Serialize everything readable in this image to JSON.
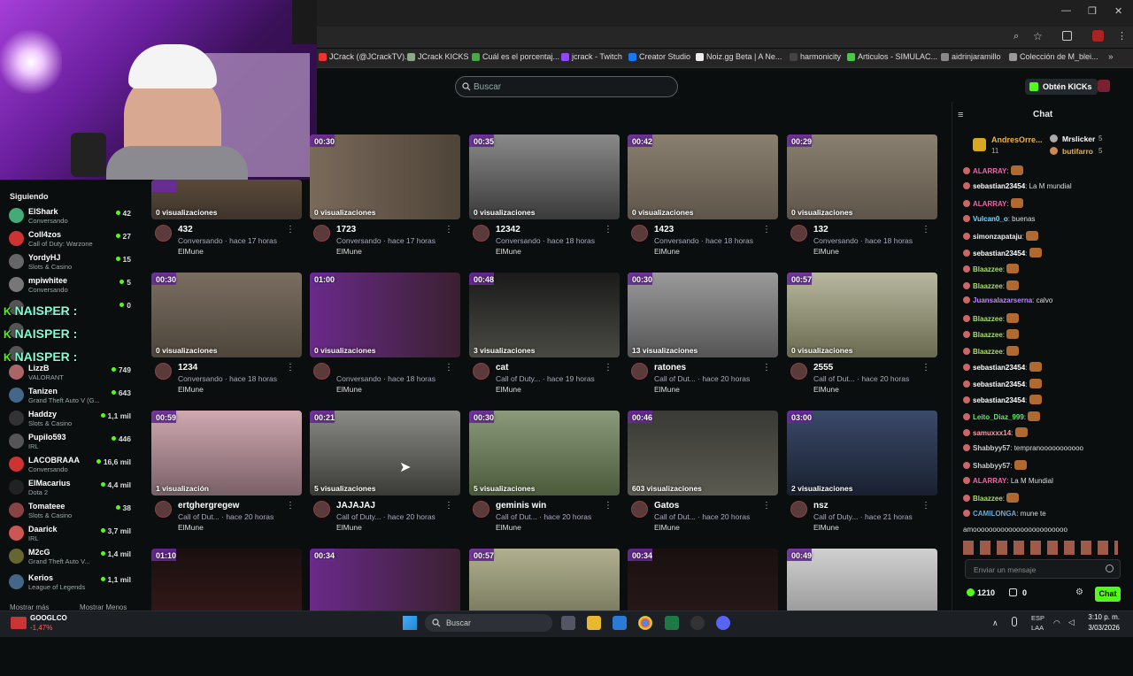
{
  "bookmarks": [
    {
      "label": "JCrack (@JCrackTV)...",
      "color": "#e33"
    },
    {
      "label": "JCrack KICKS",
      "color": "#8a8"
    },
    {
      "label": "Cuál es el porcentaj...",
      "color": "#4a4"
    },
    {
      "label": "jcrack - Twitch",
      "color": "#9146ff"
    },
    {
      "label": "Creator Studio",
      "color": "#1877f2"
    },
    {
      "label": "Noiz.gg Beta | A Ne...",
      "color": "#eee"
    },
    {
      "label": "harmonicity",
      "color": "#444"
    },
    {
      "label": "Articulos - SIMULAC...",
      "color": "#4c4"
    },
    {
      "label": "aidrinjaramillo",
      "color": "#888"
    },
    {
      "label": "Colección de M_blei...",
      "color": "#999"
    }
  ],
  "header": {
    "search_placeholder": "Buscar",
    "kicks_label": "Obtén KICKs"
  },
  "sidebar": {
    "title": "Siguiendo",
    "channels": [
      {
        "name": "ElShark",
        "category": "Conversando",
        "viewers": "42",
        "color": "#4a7"
      },
      {
        "name": "Coll4zos",
        "category": "Call of Duty: Warzone",
        "viewers": "27",
        "color": "#c33"
      },
      {
        "name": "YordyHJ",
        "category": "Slots & Casino",
        "viewers": "15",
        "color": "#666"
      },
      {
        "name": "mpiwhitee",
        "category": "Conversando",
        "viewers": "5",
        "color": "#777"
      },
      {
        "name": "",
        "category": "Conversando",
        "viewers": "0",
        "color": "#555"
      },
      {
        "name": "",
        "category": "",
        "viewers": "",
        "color": "#555"
      },
      {
        "name": "",
        "category": "",
        "viewers": "",
        "color": "#555"
      },
      {
        "name": "LizzB",
        "category": "VALORANT",
        "viewers": "749",
        "color": "#a66"
      },
      {
        "name": "Tanizen",
        "category": "Grand Theft Auto V (G...",
        "viewers": "643",
        "color": "#468"
      },
      {
        "name": "Haddzy",
        "category": "Slots & Casino",
        "viewers": "1,1 mil",
        "color": "#333"
      },
      {
        "name": "Pupilo593",
        "category": "IRL",
        "viewers": "446",
        "color": "#555"
      },
      {
        "name": "LACOBRAAA",
        "category": "Conversando",
        "viewers": "16,6 mil",
        "color": "#c33"
      },
      {
        "name": "ElMacarius",
        "category": "Dota 2",
        "viewers": "4,4 mil",
        "color": "#222"
      },
      {
        "name": "Tomateee",
        "category": "Slots & Casino",
        "viewers": "38",
        "color": "#844"
      },
      {
        "name": "Daarick",
        "category": "IRL",
        "viewers": "3,7 mil",
        "color": "#c55"
      },
      {
        "name": "M2cG",
        "category": "Grand Theft Auto V...",
        "viewers": "1,4 mil",
        "color": "#663"
      },
      {
        "name": "Kerios",
        "category": "League of Legends",
        "viewers": "1,1 mil",
        "color": "#468"
      }
    ],
    "overlay_text": "NAISPER",
    "show_more": "Mostrar más",
    "show_less": "Mostrar Menos"
  },
  "clips": [
    {
      "duration": "",
      "views": "0 visualizaciones",
      "title": "432",
      "sub": "Conversando · hace 17 horas",
      "owner": "ElMune",
      "bg": "linear-gradient(#5a4a3a,#3e342c)"
    },
    {
      "duration": "00:30",
      "views": "0 visualizaciones",
      "title": "1723",
      "sub": "Conversando · hace 17 horas",
      "owner": "ElMune",
      "bg": "linear-gradient(90deg,#7a6a5a,#4e4438)"
    },
    {
      "duration": "00:35",
      "views": "0 visualizaciones",
      "title": "12342",
      "sub": "Conversando · hace 18 horas",
      "owner": "ElMune",
      "bg": "linear-gradient(#8a8a8a,#3a3a3a)"
    },
    {
      "duration": "00:42",
      "views": "0 visualizaciones",
      "title": "1423",
      "sub": "Conversando · hace 18 horas",
      "owner": "ElMune",
      "bg": "linear-gradient(#8a8070,#5e554a)"
    },
    {
      "duration": "00:29",
      "views": "0 visualizaciones",
      "title": "132",
      "sub": "Conversando · hace 18 horas",
      "owner": "ElMune",
      "bg": "linear-gradient(#8a8070,#5e554a)"
    },
    {
      "duration": "00:30",
      "views": "0 visualizaciones",
      "title": "1234",
      "sub": "Conversando · hace 18 horas",
      "owner": "ElMune",
      "bg": "linear-gradient(#7a6e60,#4e463c)"
    },
    {
      "duration": "01:00",
      "views": "0 visualizaciones",
      "title": "",
      "sub": "Conversando · hace 18 horas",
      "owner": "ElMune",
      "bg": "linear-gradient(90deg,#6a2a8a,#3a2030)"
    },
    {
      "duration": "00:48",
      "views": "3 visualizaciones",
      "title": "cat",
      "sub": "Call of Duty... · hace 19 horas",
      "owner": "ElMune",
      "bg": "linear-gradient(#1a1a1a,#4a4a44)"
    },
    {
      "duration": "00:30",
      "views": "13 visualizaciones",
      "title": "ratones",
      "sub": "Call of Dut... · hace 20 horas",
      "owner": "ElMune",
      "bg": "linear-gradient(#9a9a9a,#555)"
    },
    {
      "duration": "00:57",
      "views": "0 visualizaciones",
      "title": "2555",
      "sub": "Call of Dut... · hace 20 horas",
      "owner": "ElMune",
      "bg": "linear-gradient(#b8b8a0,#6a6a50)"
    },
    {
      "duration": "00:59",
      "views": "1 visualización",
      "title": "ertghergregew",
      "sub": "Call of Dut... · hace 20 horas",
      "owner": "ElMune",
      "bg": "linear-gradient(#d0a8b0,#7a6068)"
    },
    {
      "duration": "00:21",
      "views": "5 visualizaciones",
      "title": "JAJAJAJ",
      "sub": "Call of Duty... · hace 20 horas",
      "owner": "ElMune",
      "bg": "linear-gradient(#8a8a86,#3a3a36)"
    },
    {
      "duration": "00:30",
      "views": "5 visualizaciones",
      "title": "geminis win",
      "sub": "Call of Dut... · hace 20 horas",
      "owner": "ElMune",
      "bg": "linear-gradient(#8a9a7a,#4a5a3a)"
    },
    {
      "duration": "00:46",
      "views": "603 visualizaciones",
      "title": "Gatos",
      "sub": "Call of Dut... · hace 20 horas",
      "owner": "ElMune",
      "bg": "linear-gradient(#3a3a36,#5a5a50)"
    },
    {
      "duration": "03:00",
      "views": "2 visualizaciones",
      "title": "nsz",
      "sub": "Call of Duty... · hace 21 horas",
      "owner": "ElMune",
      "bg": "linear-gradient(#3a4a6a,#1a2030)"
    },
    {
      "duration": "01:10",
      "views": "",
      "title": "",
      "sub": "",
      "owner": "",
      "bg": "linear-gradient(#1a1010,#3a1a1a)"
    },
    {
      "duration": "00:34",
      "views": "",
      "title": "",
      "sub": "",
      "owner": "",
      "bg": "linear-gradient(90deg,#6a2a8a,#3a2030)"
    },
    {
      "duration": "00:57",
      "views": "",
      "title": "",
      "sub": "",
      "owner": "",
      "bg": "linear-gradient(#b0b090,#6a6a50)"
    },
    {
      "duration": "00:34",
      "views": "",
      "title": "",
      "sub": "",
      "owner": "",
      "bg": "linear-gradient(#1a1010,#2a1a1a)"
    },
    {
      "duration": "00:49",
      "views": "",
      "title": "",
      "sub": "",
      "owner": "",
      "bg": "linear-gradient(#d0d0d0,#8a8a8a)"
    }
  ],
  "chat": {
    "title": "Chat",
    "top_gifters": [
      {
        "name": "AndresOrre...",
        "count": "11"
      },
      {
        "name": "Mrslicker",
        "count": "5"
      },
      {
        "name": "butifarro",
        "count": "5"
      }
    ],
    "messages": [
      {
        "user": "ALARRAY",
        "text": "",
        "color": "#e6a"
      },
      {
        "user": "sebastian23454",
        "text": "La M mundial",
        "color": "#fff"
      },
      {
        "user": "ALARRAY",
        "text": "",
        "color": "#e6a"
      },
      {
        "user": "Vulcan0_o",
        "text": "buenas",
        "color": "#7df"
      },
      {
        "user": "simonzapataju",
        "text": "",
        "color": "#eee"
      },
      {
        "user": "sebastian23454",
        "text": "",
        "color": "#fff"
      },
      {
        "user": "Blaazzee",
        "text": "",
        "color": "#ad6"
      },
      {
        "user": "Blaazzee",
        "text": "",
        "color": "#ad6"
      },
      {
        "user": "Juansalazarserna",
        "text": "calvo",
        "color": "#b8f"
      },
      {
        "user": "Blaazzee",
        "text": "",
        "color": "#ad6"
      },
      {
        "user": "Blaazzee",
        "text": "",
        "color": "#ad6"
      },
      {
        "user": "Blaazzee",
        "text": "",
        "color": "#ad6"
      },
      {
        "user": "sebastian23454",
        "text": "",
        "color": "#fff"
      },
      {
        "user": "sebastian23454",
        "text": "",
        "color": "#fff"
      },
      {
        "user": "sebastian23454",
        "text": "",
        "color": "#fff"
      },
      {
        "user": "Leito_Diaz_999",
        "text": "",
        "color": "#5e6"
      },
      {
        "user": "samuxxx14",
        "text": "",
        "color": "#f9a"
      },
      {
        "user": "Shabbyy57",
        "text": "tempranooooooooooo",
        "color": "#ccc"
      },
      {
        "user": "Shabbyy57",
        "text": "",
        "color": "#ccc"
      },
      {
        "user": "ALARRAY",
        "text": "La M Mundial",
        "color": "#e6a"
      },
      {
        "user": "Blaazzee",
        "text": "",
        "color": "#ad6"
      },
      {
        "user": "CAMILONGA",
        "text": "mune te",
        "color": "#6ad"
      },
      {
        "user": "",
        "text": "amoooooooooooooooooooooooo",
        "color": "#ccc"
      }
    ],
    "input_placeholder": "Enviar un mensaje",
    "points": "1210",
    "kicks": "0",
    "send_label": "Chat"
  },
  "taskbar": {
    "ticker_name": "GOOGLCO",
    "ticker_change": "-1,47%",
    "search_label": "Buscar",
    "lang": "ESP",
    "lang2": "LAA",
    "time": "3:10 p. m.",
    "date": "3/03/2026"
  }
}
